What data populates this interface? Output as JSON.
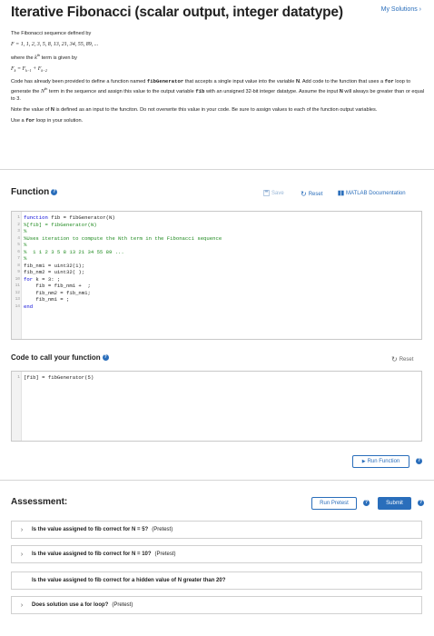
{
  "header": {
    "title": "Iterative Fibonacci (scalar output, integer datatype)",
    "my_solutions": "My Solutions ›"
  },
  "description": {
    "line1": "The Fibonacci sequence defined by",
    "line2_math": "F = 1, 1, 2, 3, 5, 8, 13, 21, 34, 55, 89, ...",
    "line3_pre": "where the",
    "line3_k": "k",
    "line3_th": "th",
    "line3_post": "term is given by",
    "line4_math": "F_k = F_{k-1} + F_{k-2}",
    "para_pre": "Code has already been provided to define a function named",
    "para_fn": "fibGenerator",
    "para_mid1": "that accepts a single input value into the variable",
    "para_N": "N",
    "para_mid2": ". Add code to the function that uses a",
    "para_for": "for",
    "para_mid3": "loop to generate the",
    "para_Nth": "N",
    "para_th": "th",
    "para_mid4": "term in the sequence and assign this value to the output variable",
    "para_fib": "fib",
    "para_mid5": "with an unsigned 32-bit integer datatype. Assume the input",
    "para_N2": "N",
    "para_end": "will always be greater than or equal to 3.",
    "note_pre": "Note the value of",
    "note_N": "N",
    "note_post": "is defined as an input to the funciton. Do not overwrite this value in your code. Be sure to assign values to each of the function output variables.",
    "use_pre": "Use a",
    "use_for": "for",
    "use_post": "loop in your solution."
  },
  "function_section": {
    "title": "Function",
    "save_label": "Save",
    "reset_label": "Reset",
    "matlab_doc_label": "MATLAB Documentation",
    "code": [
      {
        "n": "1",
        "parts": [
          {
            "t": "kw",
            "s": "function"
          },
          {
            "t": "",
            "s": " fib = fibGenerator(N)"
          }
        ]
      },
      {
        "n": "2",
        "parts": [
          {
            "t": "cm",
            "s": "%[fib] = fibGenerator(N)"
          }
        ]
      },
      {
        "n": "3",
        "parts": [
          {
            "t": "cm",
            "s": "%"
          }
        ]
      },
      {
        "n": "4",
        "parts": [
          {
            "t": "cm",
            "s": "%Uses iteration to compute the Nth term in the Fibonacci sequence"
          }
        ]
      },
      {
        "n": "5",
        "parts": [
          {
            "t": "cm",
            "s": "%"
          }
        ]
      },
      {
        "n": "6",
        "parts": [
          {
            "t": "cm",
            "s": "%  1 1 2 3 5 8 13 21 34 55 89 ..."
          }
        ]
      },
      {
        "n": "7",
        "parts": [
          {
            "t": "cm",
            "s": "%"
          }
        ]
      },
      {
        "n": "8",
        "parts": [
          {
            "t": "",
            "s": "fib_nm1 = uint32(1);"
          }
        ]
      },
      {
        "n": "9",
        "parts": [
          {
            "t": "",
            "s": "fib_nm2 = uint32( );"
          }
        ]
      },
      {
        "n": "10",
        "parts": [
          {
            "t": "kw",
            "s": "for"
          },
          {
            "t": "",
            "s": " k = 3: ;"
          }
        ]
      },
      {
        "n": "11",
        "parts": [
          {
            "t": "",
            "s": "    fib = fib_nm1 +  ;"
          }
        ]
      },
      {
        "n": "12",
        "parts": [
          {
            "t": "",
            "s": "    fib_nm2 = fib_nm1;"
          }
        ]
      },
      {
        "n": "13",
        "parts": [
          {
            "t": "",
            "s": "    fib_nm1 = ;"
          }
        ]
      },
      {
        "n": "14",
        "parts": [
          {
            "t": "kw",
            "s": "end"
          }
        ]
      }
    ]
  },
  "call_section": {
    "title": "Code to call your function",
    "reset_label": "Reset",
    "code": [
      {
        "n": "1",
        "parts": [
          {
            "t": "",
            "s": "[fib] = fibGenerator(5)"
          }
        ]
      }
    ],
    "run_function_label": "Run Function"
  },
  "assessment": {
    "title": "Assessment:",
    "run_pretest_label": "Run Pretest",
    "submit_label": "Submit",
    "items": [
      {
        "question": "Is the value assigned to fib correct for N = 5?",
        "tag": "(Pretest)",
        "chevron": true
      },
      {
        "question": "Is the value assigned to fib correct for N = 10?",
        "tag": "(Pretest)",
        "chevron": true
      },
      {
        "question": "Is the value assigned to fib correct for a hidden value of N greater than 20?",
        "tag": "",
        "chevron": false
      },
      {
        "question": "Does solution use a for loop?",
        "tag": "(Pretest)",
        "chevron": true
      }
    ]
  },
  "icons": {
    "help": "help-circle-icon",
    "save": "floppy-icon",
    "reset": "refresh-icon",
    "doc": "book-icon",
    "run": "play-icon",
    "chevron": "chevron-right-icon"
  },
  "colors": {
    "accent": "#2a6ebb",
    "keyword": "#0b0bd8",
    "comment": "#1f8a1f"
  }
}
